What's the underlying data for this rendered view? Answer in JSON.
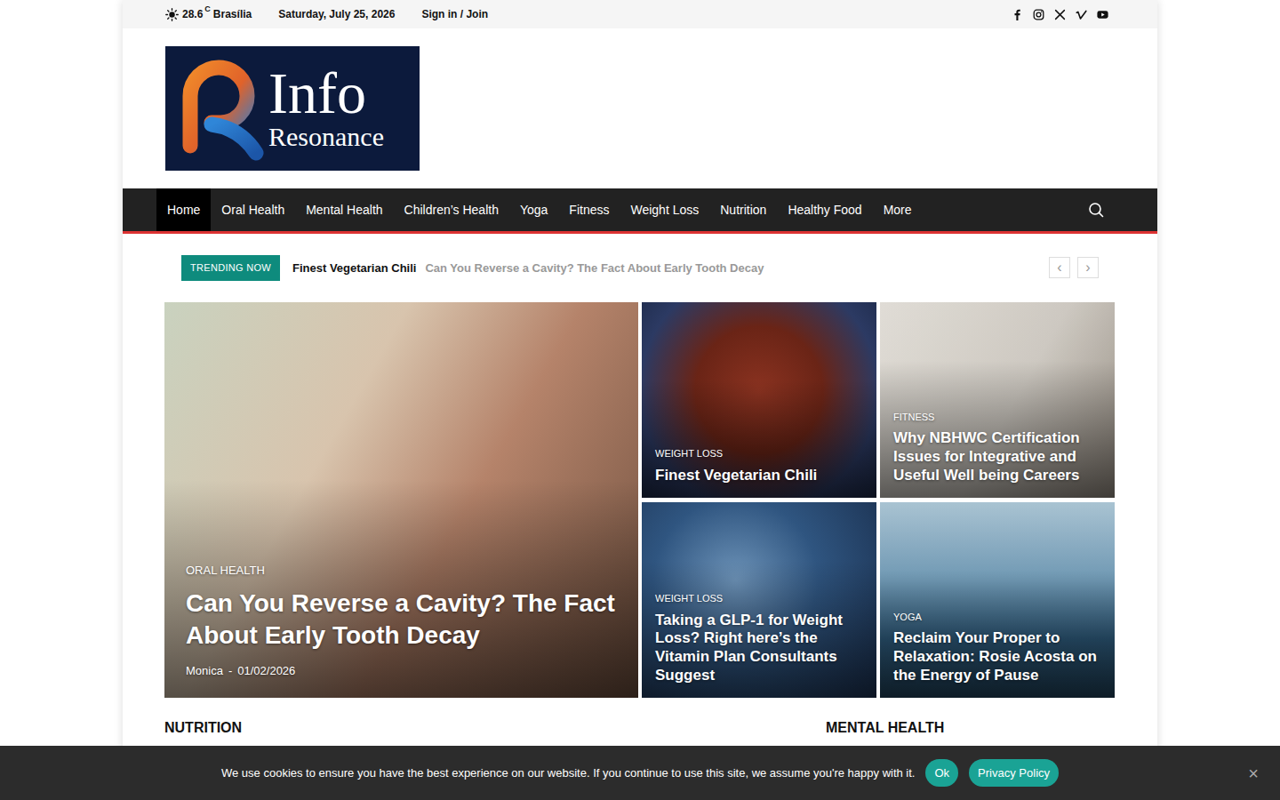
{
  "top_bar": {
    "temperature": "28.6",
    "unit": "C",
    "city": "Brasília",
    "date": "Saturday, July 25, 2026",
    "sign_in": "Sign in / Join"
  },
  "logo": {
    "line1": "Info",
    "line2": "Resonance"
  },
  "nav": {
    "items": [
      {
        "label": "Home",
        "selected": true
      },
      {
        "label": "Oral Health",
        "selected": false
      },
      {
        "label": "Mental Health",
        "selected": false
      },
      {
        "label": "Children’s Health",
        "selected": false
      },
      {
        "label": "Yoga",
        "selected": false
      },
      {
        "label": "Fitness",
        "selected": false
      },
      {
        "label": "Weight Loss",
        "selected": false
      },
      {
        "label": "Nutrition",
        "selected": false
      },
      {
        "label": "Healthy Food",
        "selected": false
      },
      {
        "label": "More",
        "selected": false
      }
    ]
  },
  "trending": {
    "label": "TRENDING NOW",
    "items": [
      {
        "title": "Finest Vegetarian Chili",
        "selected": true
      },
      {
        "title": "Can You Reverse a Cavity? The Fact About Early Tooth Decay",
        "selected": false
      }
    ],
    "prev": "‹",
    "next": "›"
  },
  "featured": [
    {
      "kind": "large",
      "category": "ORAL HEALTH",
      "title": "Can You Reverse a Cavity? The Fact About Early Tooth Decay",
      "author": "Monica",
      "separator": "-",
      "date": "01/02/2026"
    },
    {
      "kind": "small",
      "category": "WEIGHT LOSS",
      "title": "Finest Vegetarian Chili"
    },
    {
      "kind": "small",
      "category": "FITNESS",
      "title": "Why NBHWC Certification Issues for Integrative and Useful Well being Careers"
    },
    {
      "kind": "small",
      "category": "WEIGHT LOSS",
      "title": "Taking a GLP-1 for Weight Loss? Right here’s the Vitamin Plan Consultants Suggest"
    },
    {
      "kind": "small",
      "category": "YOGA",
      "title": "Reclaim Your Proper to Relaxation: Rosie Acosta on the Energy of Pause"
    }
  ],
  "sections": [
    {
      "title": "NUTRITION"
    },
    {
      "title": "MENTAL HEALTH"
    }
  ],
  "cookie": {
    "text": "We use cookies to ensure you have the best experience on our website. If you continue to use this site, we assume you're happy with it.",
    "ok": "Ok",
    "privacy": "Privacy Policy",
    "close": "×"
  }
}
